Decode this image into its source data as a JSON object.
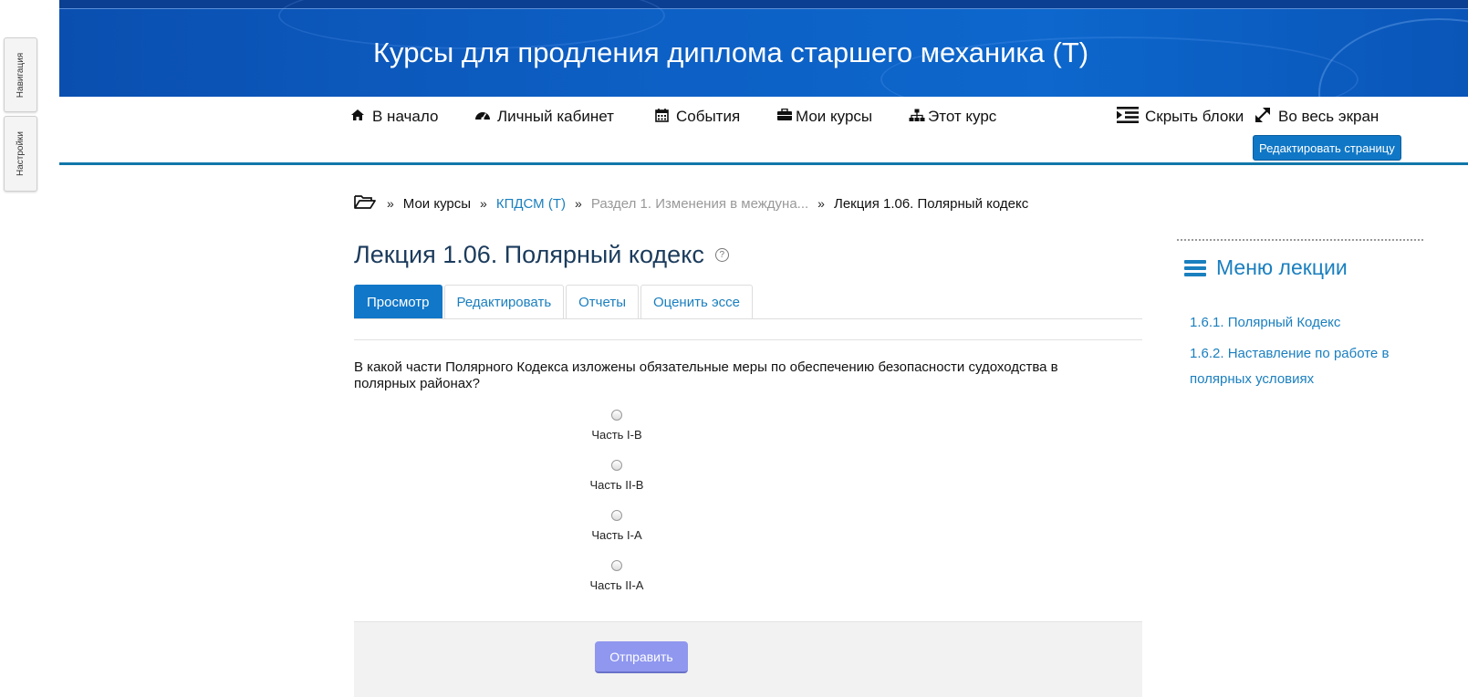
{
  "sidebar_tabs": {
    "navigation": "Навигация",
    "settings": "Настройки"
  },
  "header": {
    "title": "Курсы для продления диплома старшего механика (Т)"
  },
  "nav": {
    "items": [
      {
        "label": "В начало",
        "icon": "home-icon"
      },
      {
        "label": "Личный кабинет",
        "icon": "dashboard-icon"
      },
      {
        "label": "События",
        "icon": "calendar-icon"
      },
      {
        "label": "Мои курсы",
        "icon": "briefcase-icon"
      },
      {
        "label": "Этот курс",
        "icon": "sitemap-icon"
      },
      {
        "label": "Скрыть блоки",
        "icon": "indent-icon"
      },
      {
        "label": "Во весь экран",
        "icon": "expand-icon"
      }
    ],
    "edit_page_label": "Редактировать страницу"
  },
  "breadcrumb": {
    "sep": "»",
    "items": [
      "Мои курсы",
      "КПДСМ (Т)",
      "Раздел 1. Изменения в междуна...",
      "Лекция 1.06. Полярный кодекс"
    ]
  },
  "page": {
    "title": "Лекция 1.06. Полярный кодекс",
    "help": "?"
  },
  "tabs": [
    "Просмотр",
    "Редактировать",
    "Отчеты",
    "Оценить эссе"
  ],
  "question": {
    "text": "В какой части Полярного Кодекса изложены обязательные меры по обеспечению безопасности судоходства в полярных районах?",
    "options": [
      "Часть I-B",
      "Часть II-B",
      "Часть I-A",
      "Часть II-A"
    ],
    "submit_label": "Отправить"
  },
  "lesson_menu": {
    "title": "Меню лекции",
    "links": [
      "1.6.1. Полярный Кодекс",
      "1.6.2. Наставление по работе в полярных условиях"
    ]
  },
  "colors": {
    "accent": "#1177c8",
    "link": "#1a7fbf",
    "banner": "#0d5fc4",
    "submit": "#8f97ef"
  }
}
